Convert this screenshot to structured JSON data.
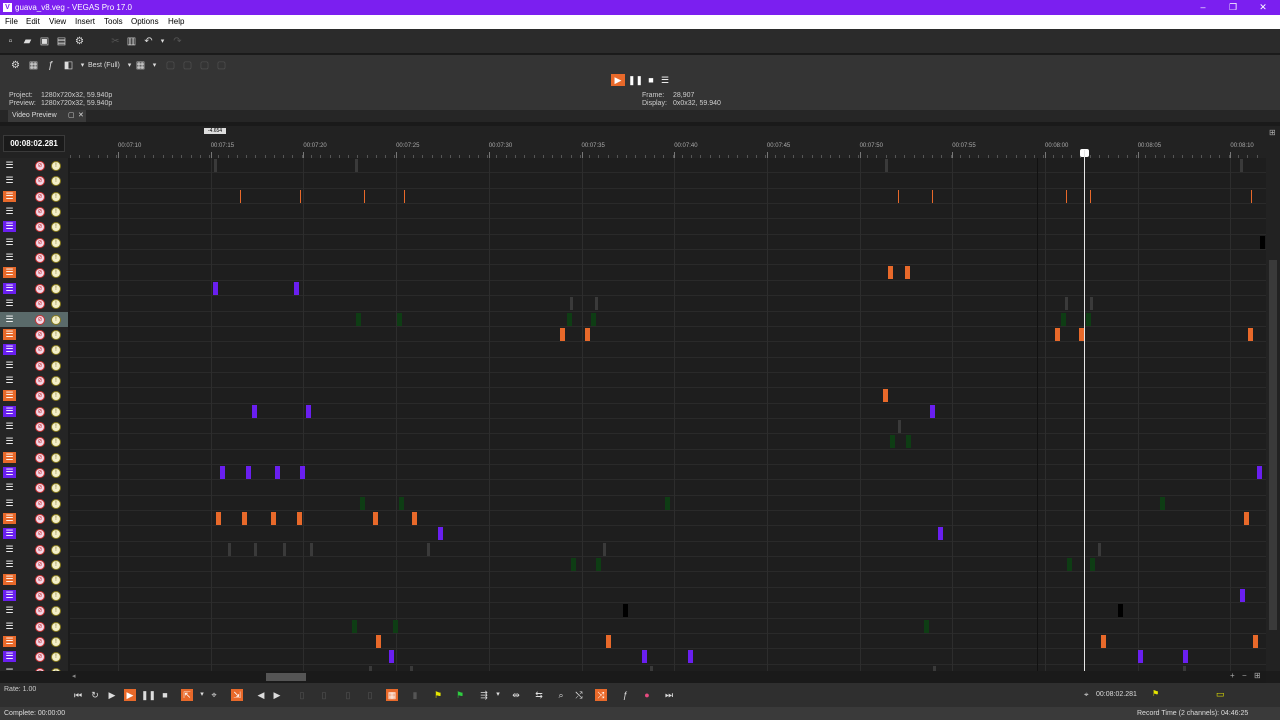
{
  "window": {
    "title": "guava_v8.veg - VEGAS Pro 17.0",
    "app_icon": "V",
    "controls": [
      "minimize-icon",
      "maximize-icon",
      "close-icon"
    ]
  },
  "menu": [
    "File",
    "Edit",
    "View",
    "Insert",
    "Tools",
    "Options",
    "Help"
  ],
  "toolbar": {
    "preview_quality": "Best (Full)"
  },
  "preview": {
    "project_label": "Project:",
    "project_value": "1280x720x32, 59.940p",
    "preview_label": "Preview:",
    "preview_value": "1280x720x32, 59.940p",
    "frame_label": "Frame:",
    "frame_value": "28,907",
    "display_label": "Display:",
    "display_value": "0x0x32, 59.940",
    "tab_label": "Video Preview"
  },
  "timeline": {
    "cursor_timecode": "00:08:02.281",
    "loop_label": "-4.654",
    "ruler_labels": [
      "00:07:10",
      "00:07:15",
      "00:07:20",
      "00:07:25",
      "00:07:30",
      "00:07:35",
      "00:07:40",
      "00:07:45",
      "00:07:50",
      "00:07:55",
      "00:08:00",
      "00:08:05",
      "00:08:10"
    ],
    "track_colors": {
      "orange": "#e8692a",
      "purple": "#6a1ff0",
      "green": "#0e3d14",
      "gray": "#3a3a3a",
      "black": "#000000"
    },
    "tracks": [
      "black",
      "black",
      "orange",
      "black",
      "purple",
      "black",
      "black",
      "orange",
      "purple",
      "black",
      "black",
      "orange",
      "purple",
      "black",
      "black",
      "orange",
      "purple",
      "black",
      "black",
      "orange",
      "purple",
      "black",
      "black",
      "orange",
      "purple",
      "black",
      "black",
      "orange",
      "purple",
      "black",
      "black",
      "orange",
      "purple",
      "black"
    ],
    "selected_track": 10
  },
  "transport": {
    "rate": "Rate: 1.00",
    "timecode": "00:08:02.281"
  },
  "status": {
    "left": "Complete: 00:00:00",
    "right": "Record Time (2 channels): 04:46:25"
  }
}
